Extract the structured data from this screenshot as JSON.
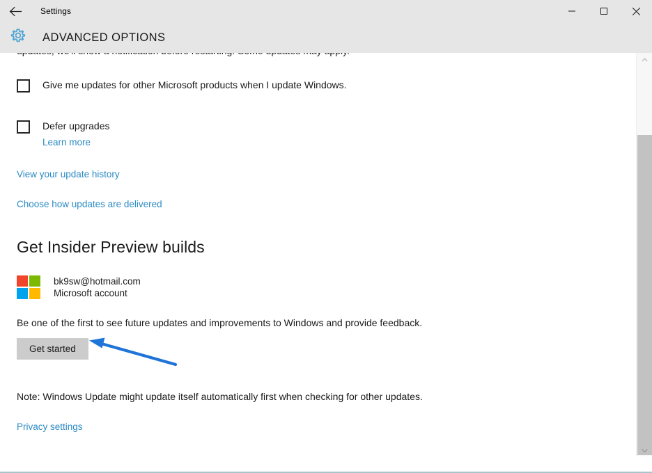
{
  "window": {
    "app_title": "Settings",
    "back_icon": "back-arrow-icon",
    "minimize_icon": "minimize-icon",
    "maximize_icon": "maximize-icon",
    "close_icon": "close-icon"
  },
  "header": {
    "gear_icon": "gear-icon",
    "page_title": "ADVANCED OPTIONS"
  },
  "content": {
    "clipped_top_text": "updates, we'll show a notification before restarting. Some updates may apply.",
    "checkboxes": [
      {
        "label": "Give me updates for other Microsoft products when I update Windows.",
        "checked": false
      },
      {
        "label": "Defer upgrades",
        "checked": false,
        "sub_link": "Learn more"
      }
    ],
    "links": [
      "View your update history",
      "Choose how updates are delivered"
    ],
    "section_heading": "Get Insider Preview builds",
    "account": {
      "email": "bk9sw@hotmail.com",
      "type": "Microsoft account",
      "logo_icon": "microsoft-logo-icon",
      "logo_colors": {
        "top_left": "#f0452a",
        "top_right": "#7db900",
        "bottom_left": "#00a3ee",
        "bottom_right": "#ffb900"
      }
    },
    "insider_description": "Be one of the first to see future updates and improvements to Windows and provide feedback.",
    "get_started_label": "Get started",
    "note_text": "Note: Windows Update might update itself automatically first when checking for other updates.",
    "privacy_link": "Privacy settings"
  },
  "annotation": {
    "arrow_icon": "annotation-arrow-icon",
    "color": "#1f74d8",
    "points_to": "Get started"
  },
  "scrollbar": {
    "up_arrow_icon": "scroll-up-arrow-icon",
    "down_arrow_icon": "scroll-down-arrow-icon",
    "thumb_icon": "scrollbar-thumb"
  },
  "theme": {
    "link_color": "#2c8bc4",
    "titlebar_bg": "#e6e6e6",
    "button_bg": "#cccccc",
    "text_color": "#1a1a1a",
    "accent_blue": "#5aa8d6"
  }
}
